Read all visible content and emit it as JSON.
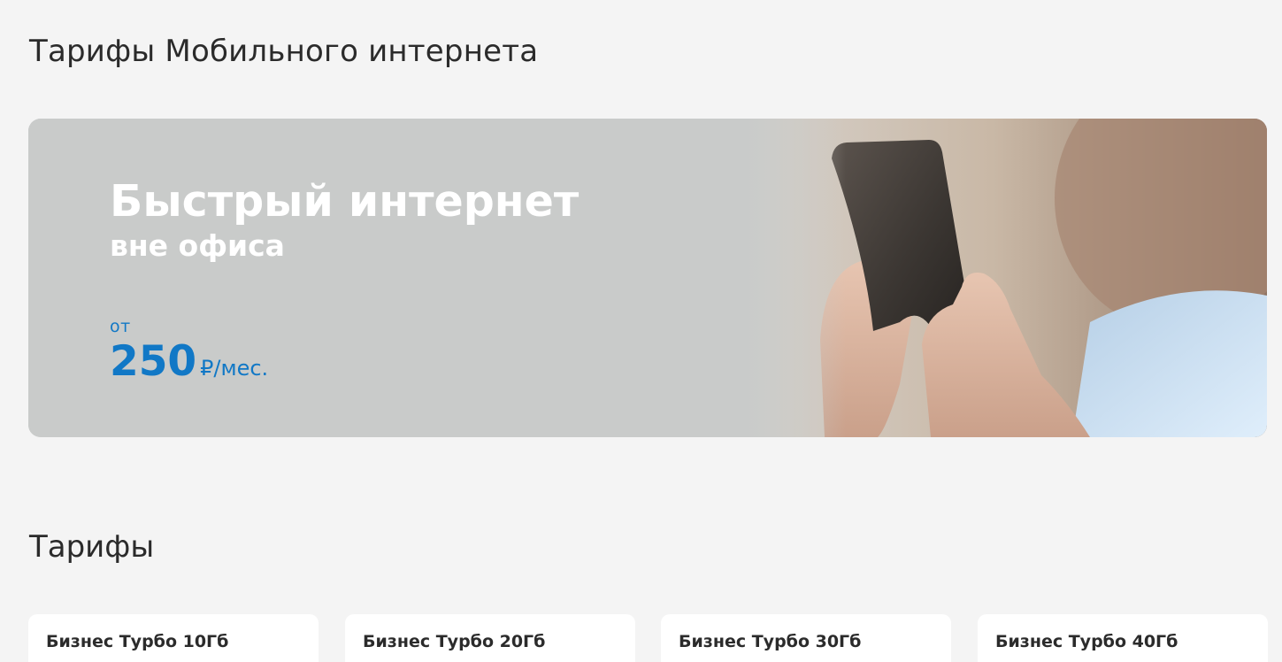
{
  "page": {
    "title": "Тарифы Мобильного интернета"
  },
  "banner": {
    "title": "Быстрый интернет",
    "subtitle": "вне офиса",
    "price_prefix": "от",
    "price_value": "250",
    "price_unit": "₽/мес.",
    "accent_color": "#1178c6"
  },
  "tariffs_section": {
    "title": "Тарифы",
    "cards": [
      {
        "name": "Бизнес Турбо 10Гб"
      },
      {
        "name": "Бизнес Турбо 20Гб"
      },
      {
        "name": "Бизнес Турбо 30Гб"
      },
      {
        "name": "Бизнес Турбо 40Гб"
      }
    ]
  }
}
